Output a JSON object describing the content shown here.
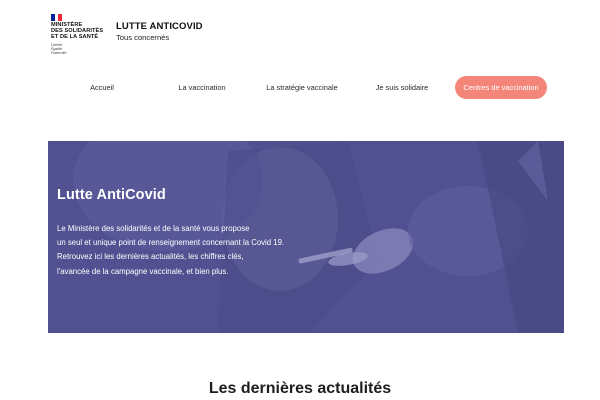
{
  "logo": {
    "flag_colors": [
      "#002395",
      "#ffffff",
      "#ed2939"
    ],
    "lines": [
      "MINISTÈRE",
      "DES SOLIDARITÉS",
      "ET DE LA SANTÉ"
    ],
    "motto": [
      "Liberté",
      "Égalité",
      "Fraternité"
    ]
  },
  "site": {
    "title": "LUTTE ANTICOVID",
    "tagline": "Tous concernés"
  },
  "nav": {
    "items": [
      {
        "label": "Accueil"
      },
      {
        "label": "La vaccination"
      },
      {
        "label": "La stratégie vaccinale"
      },
      {
        "label": "Je suis solidaire"
      }
    ],
    "cta": {
      "label": "Centres de vaccination",
      "color": "#f38679"
    }
  },
  "hero": {
    "title": "Lutte AntiCovid",
    "text": [
      "Le Ministère des solidarités et de la santé vous propose",
      "un seul et unique point de renseignement concernant la Covid 19.",
      "Retrouvez ici les dernières actualités, les chiffres clés,",
      "l'avancée de la campagne vaccinale, et bien plus."
    ],
    "overlay_color": "#515191"
  },
  "news": {
    "title": "Les dernières actualités"
  }
}
